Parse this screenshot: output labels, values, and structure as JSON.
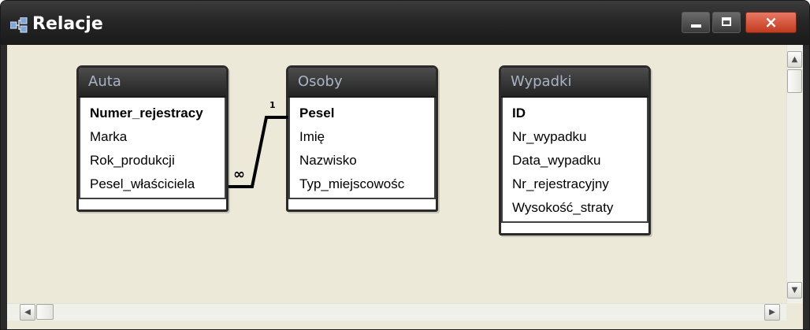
{
  "window": {
    "title": "Relacje",
    "icon": "relationships-icon",
    "controls": {
      "minimize": "minimize-icon",
      "maximize": "maximize-icon",
      "close": "×"
    }
  },
  "tables": [
    {
      "name": "Auta",
      "fields": [
        {
          "label": "Numer_rejestracy",
          "primary": true
        },
        {
          "label": "Marka",
          "primary": false
        },
        {
          "label": "Rok_produkcji",
          "primary": false
        },
        {
          "label": "Pesel_właściciela",
          "primary": false
        }
      ]
    },
    {
      "name": "Osoby",
      "fields": [
        {
          "label": "Pesel",
          "primary": true
        },
        {
          "label": "Imię",
          "primary": false
        },
        {
          "label": "Nazwisko",
          "primary": false
        },
        {
          "label": "Typ_miejscowośc",
          "primary": false
        }
      ]
    },
    {
      "name": "Wypadki",
      "fields": [
        {
          "label": "ID",
          "primary": true
        },
        {
          "label": "Nr_wypadku",
          "primary": false
        },
        {
          "label": "Data_wypadku",
          "primary": false
        },
        {
          "label": "Nr_rejestracyjny",
          "primary": false
        },
        {
          "label": "Wysokość_straty",
          "primary": false
        }
      ]
    }
  ],
  "relationships": [
    {
      "from": "Auta.Pesel_właściciela",
      "to": "Osoby.Pesel",
      "many_label": "∞",
      "one_label": "1"
    }
  ],
  "scrollbars": {
    "up": "▲",
    "down": "▼",
    "left": "◀",
    "right": "▶"
  },
  "colors": {
    "titlebar": "#262626",
    "canvas": "#ece9d8",
    "table_header_text": "#a7b4c6",
    "close_button": "#d4533a"
  }
}
